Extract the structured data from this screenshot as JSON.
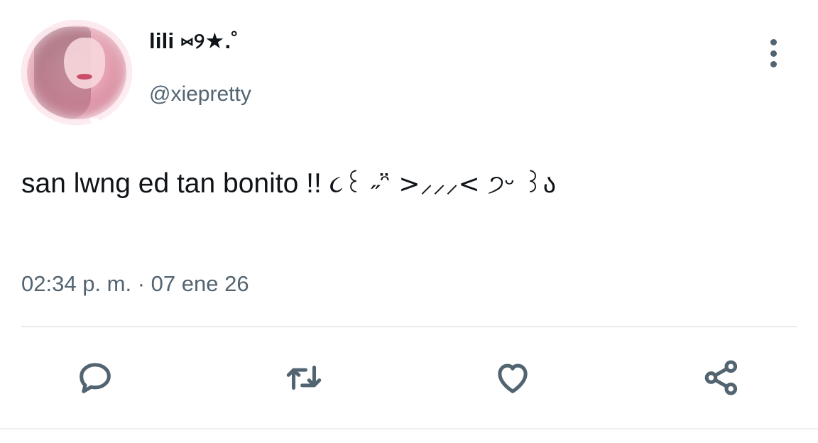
{
  "tweet": {
    "author": {
      "display_name": "lili ⑅୨★.˚",
      "handle": "@xiepretty"
    },
    "text": "san lwng ed tan bonito !! ",
    "kaomoji": "૮꒰ ˶ᵔ̈ >⸝⸝⸝< ੭ᵕ ꒱ა",
    "time": "02:34 p. m.",
    "separator": " · ",
    "date": "07 ene 26"
  },
  "actions": {
    "reply_icon": "comment-bubble",
    "retweet_icon": "retweet-arrows",
    "like_icon": "heart",
    "share_icon": "share-nodes",
    "more_icon": "vertical-ellipsis"
  },
  "colors": {
    "text_primary": "#0f1419",
    "text_secondary": "#536471",
    "divider": "#e6e9ec",
    "background": "#ffffff"
  }
}
